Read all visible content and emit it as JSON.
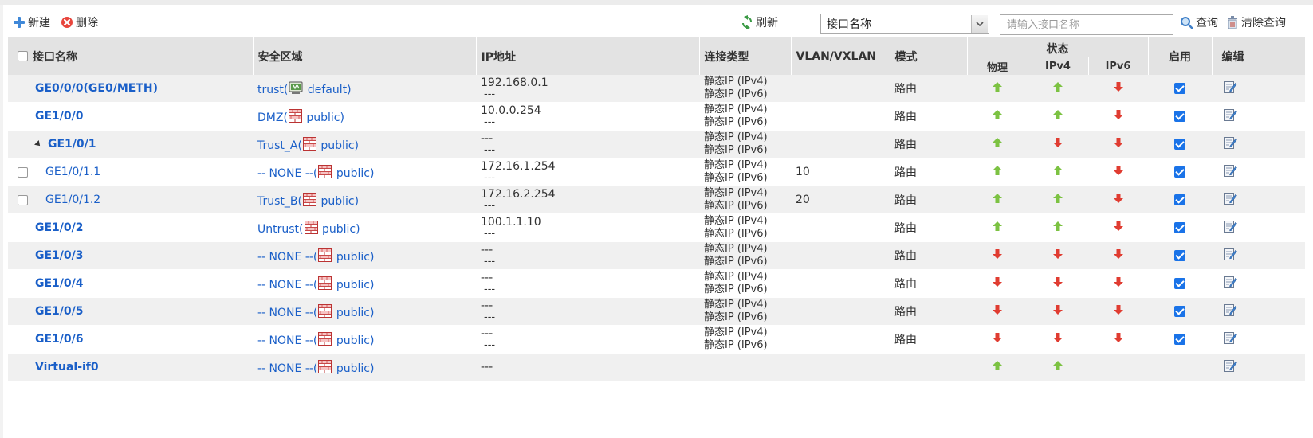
{
  "toolbar": {
    "new_label": "新建",
    "delete_label": "删除",
    "refresh_label": "刷新",
    "filter_select_value": "接口名称",
    "search_placeholder": "请输入接口名称",
    "query_label": "查询",
    "clear_label": "清除查询"
  },
  "table": {
    "headers": {
      "name": "接口名称",
      "zone": "安全区域",
      "ip": "IP地址",
      "conn_type": "连接类型",
      "vlan": "VLAN/VXLAN",
      "mode": "模式",
      "status": "状态",
      "physical": "物理",
      "ipv4": "IPv4",
      "ipv6": "IPv6",
      "enable": "启用",
      "edit": "编辑"
    },
    "rows": [
      {
        "name": "GE0/0/0(GE0/METH)",
        "zone": "trust",
        "vsys": "default",
        "ip1": "192.168.0.1",
        "ip2": "---",
        "ct1": "静态IP (IPv4)",
        "ct2": "静态IP (IPv6)",
        "vlan": "",
        "mode": "路由",
        "phy": "up",
        "v4": "up",
        "v6": "down",
        "enabled": true,
        "sub": false,
        "expand": false,
        "check": false
      },
      {
        "name": "GE1/0/0",
        "zone": "DMZ",
        "vsys": "public",
        "ip1": "10.0.0.254",
        "ip2": "---",
        "ct1": "静态IP (IPv4)",
        "ct2": "静态IP (IPv6)",
        "vlan": "",
        "mode": "路由",
        "phy": "up",
        "v4": "up",
        "v6": "down",
        "enabled": true,
        "sub": false,
        "expand": false,
        "check": false
      },
      {
        "name": "GE1/0/1",
        "zone": "Trust_A",
        "vsys": "public",
        "ip1": "---",
        "ip2": "---",
        "ct1": "静态IP (IPv4)",
        "ct2": "静态IP (IPv6)",
        "vlan": "",
        "mode": "路由",
        "phy": "up",
        "v4": "down",
        "v6": "down",
        "enabled": true,
        "sub": false,
        "expand": true,
        "check": false
      },
      {
        "name": "GE1/0/1.1",
        "zone": "-- NONE --",
        "vsys": "public",
        "ip1": "172.16.1.254",
        "ip2": "---",
        "ct1": "静态IP (IPv4)",
        "ct2": "静态IP (IPv6)",
        "vlan": "10",
        "mode": "路由",
        "phy": "up",
        "v4": "up",
        "v6": "down",
        "enabled": true,
        "sub": true,
        "expand": false,
        "check": true
      },
      {
        "name": "GE1/0/1.2",
        "zone": "Trust_B",
        "vsys": "public",
        "ip1": "172.16.2.254",
        "ip2": "---",
        "ct1": "静态IP (IPv4)",
        "ct2": "静态IP (IPv6)",
        "vlan": "20",
        "mode": "路由",
        "phy": "up",
        "v4": "up",
        "v6": "down",
        "enabled": true,
        "sub": true,
        "expand": false,
        "check": true
      },
      {
        "name": "GE1/0/2",
        "zone": "Untrust",
        "vsys": "public",
        "ip1": "100.1.1.10",
        "ip2": "---",
        "ct1": "静态IP (IPv4)",
        "ct2": "静态IP (IPv6)",
        "vlan": "",
        "mode": "路由",
        "phy": "up",
        "v4": "up",
        "v6": "down",
        "enabled": true,
        "sub": false,
        "expand": false,
        "check": false
      },
      {
        "name": "GE1/0/3",
        "zone": "-- NONE --",
        "vsys": "public",
        "ip1": "---",
        "ip2": "---",
        "ct1": "静态IP (IPv4)",
        "ct2": "静态IP (IPv6)",
        "vlan": "",
        "mode": "路由",
        "phy": "down",
        "v4": "down",
        "v6": "down",
        "enabled": true,
        "sub": false,
        "expand": false,
        "check": false
      },
      {
        "name": "GE1/0/4",
        "zone": "-- NONE --",
        "vsys": "public",
        "ip1": "---",
        "ip2": "---",
        "ct1": "静态IP (IPv4)",
        "ct2": "静态IP (IPv6)",
        "vlan": "",
        "mode": "路由",
        "phy": "down",
        "v4": "down",
        "v6": "down",
        "enabled": true,
        "sub": false,
        "expand": false,
        "check": false
      },
      {
        "name": "GE1/0/5",
        "zone": "-- NONE --",
        "vsys": "public",
        "ip1": "---",
        "ip2": "---",
        "ct1": "静态IP (IPv4)",
        "ct2": "静态IP (IPv6)",
        "vlan": "",
        "mode": "路由",
        "phy": "down",
        "v4": "down",
        "v6": "down",
        "enabled": true,
        "sub": false,
        "expand": false,
        "check": false
      },
      {
        "name": "GE1/0/6",
        "zone": "-- NONE --",
        "vsys": "public",
        "ip1": "---",
        "ip2": "---",
        "ct1": "静态IP (IPv4)",
        "ct2": "静态IP (IPv6)",
        "vlan": "",
        "mode": "路由",
        "phy": "down",
        "v4": "down",
        "v6": "down",
        "enabled": true,
        "sub": false,
        "expand": false,
        "check": false
      },
      {
        "name": "Virtual-if0",
        "zone": "-- NONE --",
        "vsys": "public",
        "ip1": "---",
        "ip2": "",
        "ct1": "",
        "ct2": "",
        "vlan": "",
        "mode": "",
        "phy": "up",
        "v4": "up",
        "v6": "",
        "enabled": null,
        "sub": false,
        "expand": false,
        "check": false
      }
    ]
  },
  "colors": {
    "link": "#1a5fc8",
    "status_up": "#7cc242",
    "status_down": "#e03c31",
    "checkbox": "#1a73e8",
    "header_bg": "#e3e3e3",
    "row_alt_bg": "#f0f0f0"
  },
  "icons": {
    "new": "plus-icon",
    "delete": "x-icon",
    "refresh": "refresh-icon",
    "query": "magnifier-icon",
    "clear": "trash-icon",
    "vsys_default": "vsys-icon",
    "vsys_public": "firewall-icon",
    "edit": "edit-icon"
  }
}
